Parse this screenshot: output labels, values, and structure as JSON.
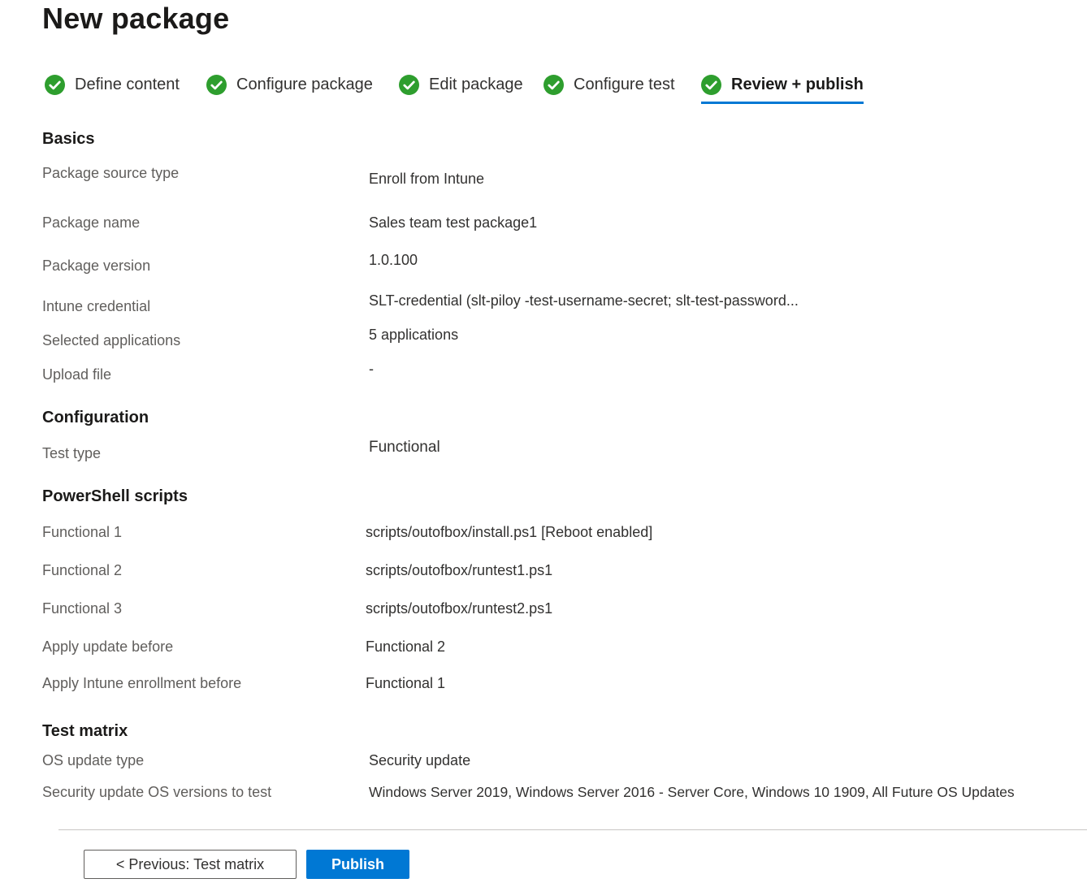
{
  "page": {
    "title": "New package"
  },
  "steps": [
    {
      "label": "Define content",
      "status": "complete"
    },
    {
      "label": "Configure package",
      "status": "complete"
    },
    {
      "label": "Edit package",
      "status": "complete"
    },
    {
      "label": "Configure test",
      "status": "complete"
    },
    {
      "label": "Review + publish",
      "status": "active"
    }
  ],
  "colors": {
    "check_green": "#2e9e2e",
    "accent_blue": "#0078d4"
  },
  "icons": {
    "step_status": "checkmark-circle-icon"
  },
  "basics": {
    "heading": "Basics",
    "rows": [
      {
        "label": "Package source type",
        "value": "Enroll from Intune"
      },
      {
        "label": "Package name",
        "value": "Sales team test package1"
      },
      {
        "label": "Package version",
        "value": "1.0.100"
      },
      {
        "label": "Intune credential",
        "value": "SLT-credential (slt-piloy -test-username-secret; slt-test-password..."
      },
      {
        "label": "Selected applications",
        "value": "5 applications"
      },
      {
        "label": "Upload file",
        "value": "-"
      }
    ]
  },
  "configuration": {
    "heading": "Configuration",
    "rows": [
      {
        "label": "Test type",
        "value": "Functional"
      }
    ]
  },
  "powershell": {
    "heading": "PowerShell scripts",
    "rows": [
      {
        "label": "Functional 1",
        "value": "scripts/outofbox/install.ps1 [Reboot enabled]"
      },
      {
        "label": "Functional 2",
        "value": "scripts/outofbox/runtest1.ps1"
      },
      {
        "label": "Functional 3",
        "value": "scripts/outofbox/runtest2.ps1"
      },
      {
        "label": "Apply update before",
        "value": "Functional 2"
      },
      {
        "label": "Apply Intune enrollment before",
        "value": "Functional 1"
      }
    ]
  },
  "test_matrix": {
    "heading": "Test matrix",
    "rows": [
      {
        "label": "OS update type",
        "value": "Security update"
      },
      {
        "label": "Security update OS versions to test",
        "value": "Windows Server 2019, Windows Server 2016 - Server Core, Windows 10 1909, All Future OS Updates"
      }
    ]
  },
  "footer": {
    "previous_label": "< Previous: Test matrix",
    "publish_label": "Publish"
  }
}
